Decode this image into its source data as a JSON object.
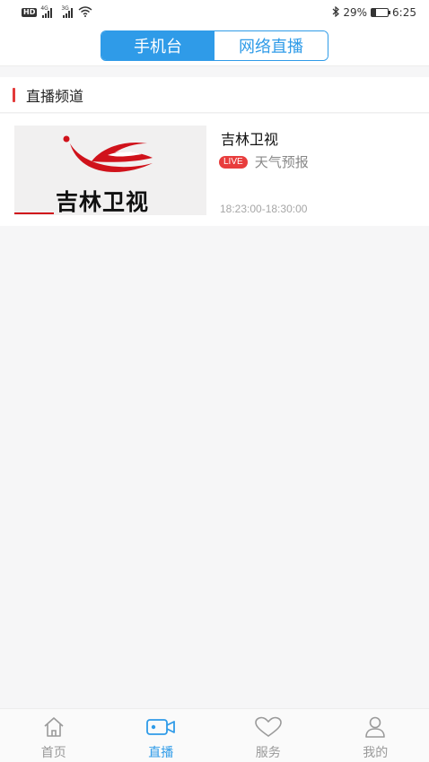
{
  "status_bar": {
    "hd": "HD",
    "sim1": "4G",
    "sim2": "3G",
    "battery_text": "29%",
    "battery_level": 0.29,
    "time": "6:25"
  },
  "header": {
    "tabs": [
      {
        "label": "手机台",
        "active": true
      },
      {
        "label": "网络直播",
        "active": false
      }
    ]
  },
  "section": {
    "title": "直播频道"
  },
  "channels": [
    {
      "name": "吉林卫视",
      "logo_text": "吉林卫视",
      "live_badge": "LIVE",
      "program": "天气预报",
      "time": "18:23:00-18:30:00"
    }
  ],
  "bottom_nav": {
    "items": [
      {
        "label": "首页",
        "icon": "home-icon",
        "active": false
      },
      {
        "label": "直播",
        "icon": "live-tv-icon",
        "active": true
      },
      {
        "label": "服务",
        "icon": "heart-icon",
        "active": false
      },
      {
        "label": "我的",
        "icon": "user-icon",
        "active": false
      }
    ]
  },
  "colors": {
    "accent": "#2f9be8",
    "live": "#e83d3d",
    "section_bar": "#e33a3a"
  }
}
